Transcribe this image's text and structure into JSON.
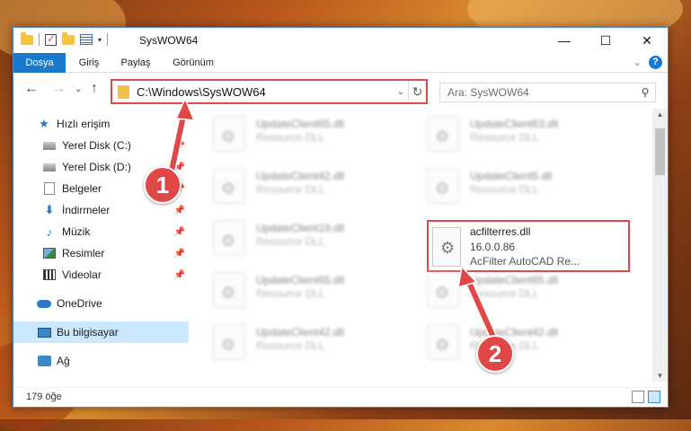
{
  "titlebar": {
    "title": "SysWOW64",
    "qat_dropdown": "▾",
    "minimize": "—",
    "maximize": "☐",
    "close": "✕"
  },
  "ribbon": {
    "tabs": [
      "Dosya",
      "Giriş",
      "Paylaş",
      "Görünüm"
    ],
    "expand": "⌄",
    "help": "?"
  },
  "nav": {
    "back": "←",
    "forward": "→",
    "recent": "⌄",
    "up": "↑",
    "address": "C:\\Windows\\SysWOW64",
    "address_chevron": "⌄",
    "refresh": "↻",
    "search_placeholder": "Ara: SysWOW64",
    "search_icon": "⚲"
  },
  "sidebar": {
    "items": [
      {
        "label": "Hızlı erişim",
        "icon": "star-icon",
        "pinned": false
      },
      {
        "label": "Yerel Disk (C:)",
        "icon": "drive-icon",
        "pinned": true
      },
      {
        "label": "Yerel Disk (D:)",
        "icon": "drive-icon",
        "pinned": true
      },
      {
        "label": "Belgeler",
        "icon": "document-icon",
        "pinned": true
      },
      {
        "label": "İndirmeler",
        "icon": "download-icon",
        "pinned": true
      },
      {
        "label": "Müzik",
        "icon": "music-icon",
        "pinned": true
      },
      {
        "label": "Resimler",
        "icon": "pictures-icon",
        "pinned": true
      },
      {
        "label": "Videolar",
        "icon": "video-icon",
        "pinned": true
      },
      {
        "label": "OneDrive",
        "icon": "cloud-icon",
        "pinned": false
      },
      {
        "label": "Bu bilgisayar",
        "icon": "pc-icon",
        "pinned": false
      },
      {
        "label": "Ağ",
        "icon": "network-icon",
        "pinned": false
      }
    ],
    "pin_glyph": "📌"
  },
  "files": [
    {
      "name": "UpdateClient65.dll",
      "desc": "Resource DLL"
    },
    {
      "name": "UpdateClient63.dll",
      "desc": "Resource DLL"
    },
    {
      "name": "UpdateClient42.dll",
      "desc": "Resource DLL"
    },
    {
      "name": "UpdateClient5.dll",
      "desc": "Resource DLL"
    },
    {
      "name": "UpdateClient19.dll",
      "desc": "Resource DLL"
    },
    {
      "name": "acfilterres.dll",
      "version": "16.0.0.86",
      "desc": "AcFilter AutoCAD Re..."
    },
    {
      "name": "UpdateClient65.dll",
      "desc": "Resource DLL"
    },
    {
      "name": "UpdateClient65.dll",
      "desc": "Resource DLL"
    },
    {
      "name": "UpdateClient42.dll",
      "desc": "Resource DLL"
    },
    {
      "name": "UpdateClient42.dll",
      "desc": "Resource DLL"
    }
  ],
  "status": {
    "count": "179 öğe"
  },
  "annotations": {
    "step1": "1",
    "step2": "2"
  },
  "colors": {
    "accent": "#1979ca",
    "highlight": "#e04848",
    "selected": "#cce8ff"
  }
}
